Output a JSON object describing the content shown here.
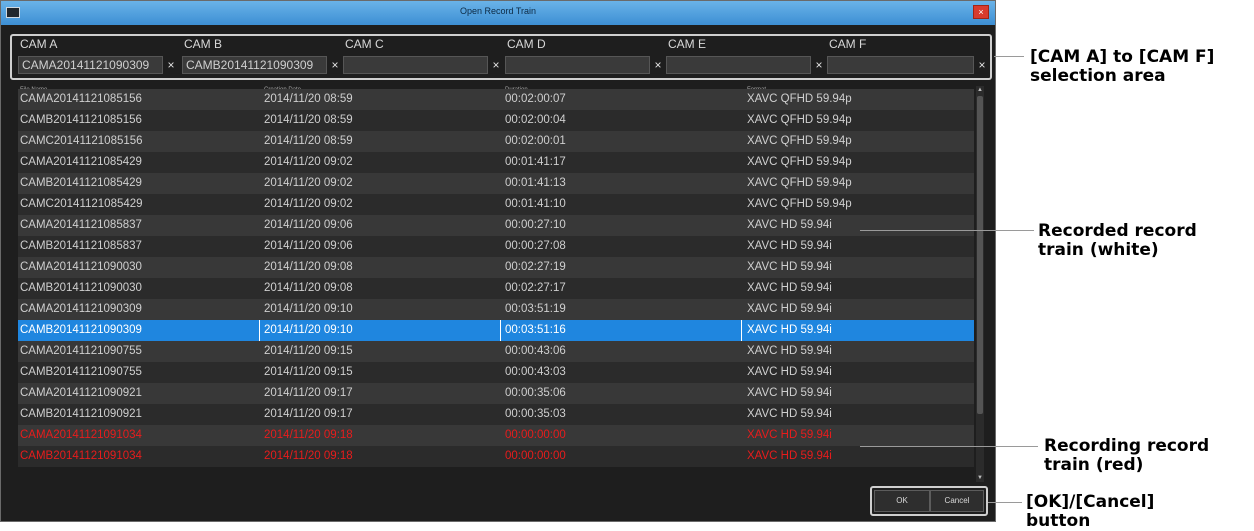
{
  "window": {
    "app_icon": "app-icon",
    "title": "Open Record Train",
    "close_label": "×"
  },
  "cameras": [
    {
      "label": "CAM A",
      "value": "CAMA20141121090309",
      "clear": "×"
    },
    {
      "label": "CAM B",
      "value": "CAMB20141121090309",
      "clear": "×"
    },
    {
      "label": "CAM C",
      "value": "",
      "clear": "×"
    },
    {
      "label": "CAM D",
      "value": "",
      "clear": "×"
    },
    {
      "label": "CAM E",
      "value": "",
      "clear": "×"
    },
    {
      "label": "CAM F",
      "value": "",
      "clear": "×"
    }
  ],
  "table": {
    "headers": [
      "File Name",
      "Creation Date",
      "Duration",
      "Format"
    ],
    "rows": [
      [
        "CAMA20141121085156",
        "2014/11/20 08:59",
        "00:02:00:07",
        "XAVC QFHD 59.94p"
      ],
      [
        "CAMB20141121085156",
        "2014/11/20 08:59",
        "00:02:00:04",
        "XAVC QFHD 59.94p"
      ],
      [
        "CAMC20141121085156",
        "2014/11/20 08:59",
        "00:02:00:01",
        "XAVC QFHD 59.94p"
      ],
      [
        "CAMA20141121085429",
        "2014/11/20 09:02",
        "00:01:41:17",
        "XAVC QFHD 59.94p"
      ],
      [
        "CAMB20141121085429",
        "2014/11/20 09:02",
        "00:01:41:13",
        "XAVC QFHD 59.94p"
      ],
      [
        "CAMC20141121085429",
        "2014/11/20 09:02",
        "00:01:41:10",
        "XAVC QFHD 59.94p"
      ],
      [
        "CAMA20141121085837",
        "2014/11/20 09:06",
        "00:00:27:10",
        "XAVC HD 59.94i"
      ],
      [
        "CAMB20141121085837",
        "2014/11/20 09:06",
        "00:00:27:08",
        "XAVC HD 59.94i"
      ],
      [
        "CAMA20141121090030",
        "2014/11/20 09:08",
        "00:02:27:19",
        "XAVC HD 59.94i"
      ],
      [
        "CAMB20141121090030",
        "2014/11/20 09:08",
        "00:02:27:17",
        "XAVC HD 59.94i"
      ],
      [
        "CAMA20141121090309",
        "2014/11/20 09:10",
        "00:03:51:19",
        "XAVC HD 59.94i"
      ],
      [
        "CAMB20141121090309",
        "2014/11/20 09:10",
        "00:03:51:16",
        "XAVC HD 59.94i"
      ],
      [
        "CAMA20141121090755",
        "2014/11/20 09:15",
        "00:00:43:06",
        "XAVC HD 59.94i"
      ],
      [
        "CAMB20141121090755",
        "2014/11/20 09:15",
        "00:00:43:03",
        "XAVC HD 59.94i"
      ],
      [
        "CAMA20141121090921",
        "2014/11/20 09:17",
        "00:00:35:06",
        "XAVC HD 59.94i"
      ],
      [
        "CAMB20141121090921",
        "2014/11/20 09:17",
        "00:00:35:03",
        "XAVC HD 59.94i"
      ],
      [
        "CAMA20141121091034",
        "2014/11/20 09:18",
        "00:00:00:00",
        "XAVC HD 59.94i"
      ],
      [
        "CAMB20141121091034",
        "2014/11/20 09:18",
        "00:00:00:00",
        "XAVC HD 59.94i"
      ]
    ],
    "selected_row": 11,
    "recording_rows": [
      16,
      17
    ]
  },
  "colors": {
    "selection": "#1f86df",
    "recording_text": "#e81c1c",
    "recorded_text": "#cfcfcf"
  },
  "scroll": {
    "up_icon": "▲",
    "down_icon": "▼"
  },
  "buttons": {
    "ok": "OK",
    "cancel": "Cancel"
  },
  "callouts": {
    "cam_selection": [
      "[CAM A] to [CAM F]",
      "selection area"
    ],
    "recorded": [
      "Recorded record",
      "train (white)"
    ],
    "recording": [
      "Recording record",
      "train (red)"
    ],
    "ok_cancel": [
      "[OK]/[Cancel]",
      "button"
    ]
  }
}
